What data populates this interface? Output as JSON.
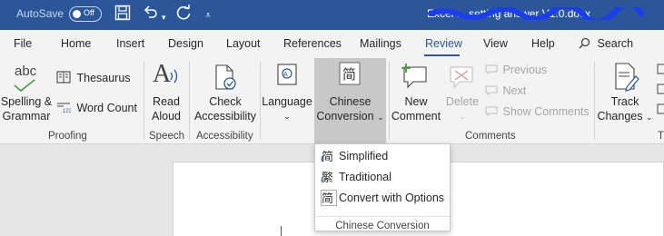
{
  "titlebar": {
    "autosave_label": "AutoSave",
    "autosave_state": "Off",
    "doc_name": "Excel ... setting answer V1.0.docx"
  },
  "tabs": [
    {
      "label": "File"
    },
    {
      "label": "Home"
    },
    {
      "label": "Insert"
    },
    {
      "label": "Design"
    },
    {
      "label": "Layout"
    },
    {
      "label": "References"
    },
    {
      "label": "Mailings"
    },
    {
      "label": "Review"
    },
    {
      "label": "View"
    },
    {
      "label": "Help"
    }
  ],
  "search": {
    "label": "Search"
  },
  "ribbon": {
    "proofing": {
      "spelling_label_1": "Spelling &",
      "spelling_label_2": "Grammar",
      "abc": "abc",
      "thesaurus": "Thesaurus",
      "word_count": "Word Count",
      "group": "Proofing"
    },
    "speech": {
      "read_aloud_1": "Read",
      "read_aloud_2": "Aloud",
      "group": "Speech"
    },
    "accessibility": {
      "check_1": "Check",
      "check_2": "Accessibility",
      "group": "Accessibility"
    },
    "language": {
      "label": "Language"
    },
    "chinese": {
      "label_1": "Chinese",
      "label_2": "Conversion"
    },
    "comments": {
      "new_1": "New",
      "new_2": "Comment",
      "delete": "Delete",
      "previous": "Previous",
      "next": "Next",
      "show": "Show Comments",
      "group": "Comments"
    },
    "tracking": {
      "track_1": "Track",
      "track_2": "Changes",
      "group_partial": "T"
    }
  },
  "dropdown": {
    "items": [
      {
        "label": "Simplified",
        "icon": "simplified-char-icon"
      },
      {
        "label": "Traditional",
        "icon": "traditional-char-icon"
      },
      {
        "label": "Convert with Options",
        "icon": "convert-options-icon"
      }
    ],
    "footer": "Chinese Conversion"
  },
  "colors": {
    "titlebar": "#2b579a",
    "accent": "#2b579a",
    "ribbon": "#f3f3f3",
    "pressed": "#c8c8c8"
  }
}
